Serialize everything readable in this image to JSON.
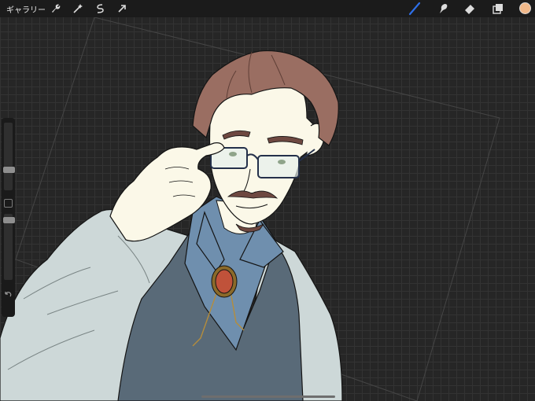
{
  "topbar": {
    "gallery_label": "ギャラリー",
    "left_icons": [
      "wrench-icon",
      "magic-wand-icon",
      "selection-icon",
      "transform-arrow-icon"
    ],
    "right_icons": [
      "brush-icon",
      "smudge-icon",
      "eraser-icon",
      "layers-icon"
    ],
    "active_tool": "brush",
    "active_color": "#f0b88a",
    "accent_color": "#2e6fe8"
  },
  "sidebar": {
    "controls": [
      "brush-size-slider",
      "modify-button",
      "opacity-slider",
      "undo-button"
    ]
  },
  "canvas": {
    "subject": "artwork"
  }
}
